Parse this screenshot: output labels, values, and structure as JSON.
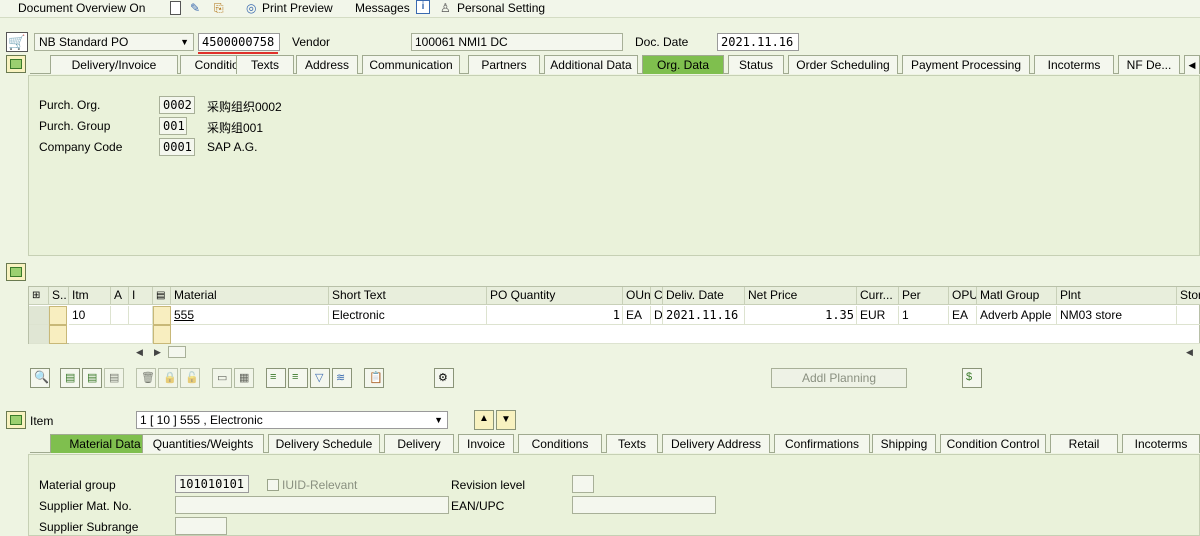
{
  "toolbar": {
    "doc_overview": "Document Overview On",
    "print_preview": "Print Preview",
    "messages": "Messages",
    "personal_setting": "Personal Setting"
  },
  "header": {
    "doc_type": "NB Standard PO",
    "po_number": "4500000758",
    "vendor_label": "Vendor",
    "vendor_value": "100061 NMI1 DC",
    "docdate_label": "Doc. Date",
    "docdate_value": "2021.11.16"
  },
  "header_tabs": [
    "Delivery/Invoice",
    "Conditions",
    "Texts",
    "Address",
    "Communication",
    "Partners",
    "Additional Data",
    "Org. Data",
    "Status",
    "Order Scheduling",
    "Payment Processing",
    "Incoterms",
    "NF De..."
  ],
  "org_data": {
    "purch_org_label": "Purch. Org.",
    "purch_org_value": "0002",
    "purch_org_desc": "采购组织0002",
    "purch_group_label": "Purch. Group",
    "purch_group_value": "001",
    "purch_group_desc": "采购组001",
    "company_code_label": "Company Code",
    "company_code_value": "0001",
    "company_code_desc": "SAP A.G."
  },
  "items_table": {
    "columns": [
      "S..",
      "Itm",
      "A",
      "I",
      "",
      "Material",
      "Short Text",
      "PO Quantity",
      "OUn",
      "C",
      "Deliv. Date",
      "Net Price",
      "Curr...",
      "Per",
      "OPU",
      "Matl Group",
      "Plnt",
      "Stor"
    ],
    "rows": [
      {
        "itm": "10",
        "material": "555",
        "short_text": "Electronic",
        "po_quantity": "1",
        "oun": "EA",
        "c": "D",
        "deliv_date": "2021.11.16",
        "net_price": "1.35",
        "curr": "EUR",
        "per": "1",
        "opu": "EA",
        "matl_group": "Adverb Apple",
        "plnt": "NM03 store"
      }
    ]
  },
  "addl_planning": "Addl Planning",
  "item_section": {
    "label": "Item",
    "selector_value": "1 [ 10 ] 555 , Electronic"
  },
  "item_tabs": [
    "Material Data",
    "Quantities/Weights",
    "Delivery Schedule",
    "Delivery",
    "Invoice",
    "Conditions",
    "Texts",
    "Delivery Address",
    "Confirmations",
    "Shipping",
    "Condition Control",
    "Retail",
    "Incoterms"
  ],
  "material_data": {
    "material_group_label": "Material group",
    "material_group_value": "101010101",
    "iuid_label": "IUID-Relevant",
    "revision_label": "Revision level",
    "supplier_mat_label": "Supplier Mat. No.",
    "ean_label": "EAN/UPC",
    "supplier_subrange_label": "Supplier Subrange"
  },
  "colors": {
    "active_tab": "#7fbf4e",
    "background": "#eef4e2",
    "underline": "#e0302a"
  }
}
